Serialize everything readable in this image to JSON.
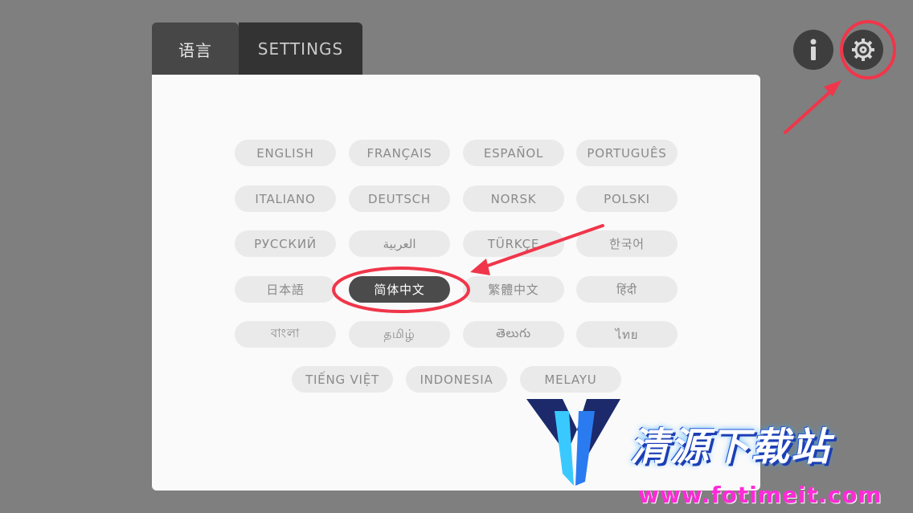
{
  "tabs": {
    "language_label": "语言",
    "settings_label": "SETTINGS"
  },
  "languages": [
    "ENGLISH",
    "FRANÇAIS",
    "ESPAÑOL",
    "PORTUGUÊS",
    "ITALIANO",
    "DEUTSCH",
    "NORSK",
    "POLSKI",
    "РУССКИЙ",
    "العربية",
    "TÜRKÇE",
    "한국어",
    "日本語",
    "简体中文",
    "繁體中文",
    "हिंदी",
    "বাংলা",
    "தமிழ்",
    "తెలుగు",
    "ไทย",
    "TIẾNG VIỆT",
    "INDONESIA",
    "MELAYU"
  ],
  "selected_language": "简体中文",
  "header_icons": {
    "info": "info-icon",
    "settings": "gear-icon"
  },
  "watermark": {
    "title": "清源下载站",
    "url": "www.fotimeit.com"
  },
  "colors": {
    "annotation": "#f0364a",
    "selected_bg": "#4b4b4b",
    "pill_bg": "#eaeaea"
  }
}
